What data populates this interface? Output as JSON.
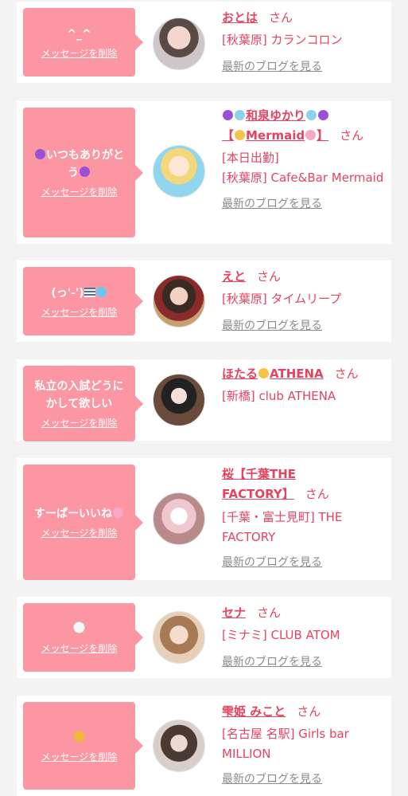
{
  "common": {
    "delete_label": "メッセージを削除",
    "honorific": "さん",
    "blog_label": "最新のブログを見る"
  },
  "cards": [
    {
      "message": "^_^",
      "name": "おとは",
      "store_lines": [
        "[秋葉原] カランコロン"
      ]
    },
    {
      "message_pre": "",
      "message_text": "いつもありがとう",
      "message_post": "",
      "message_icons": [
        "purple-heart-icon",
        "purple-heart-icon"
      ],
      "name_part1": "和泉ゆかり",
      "name_part2": "【",
      "name_part3": "Mermaid",
      "name_part4": "】",
      "name_icons": [
        "purple-heart-icon",
        "snowflake-icon",
        "snowflake-icon",
        "purple-heart-icon",
        "bouquet-icon",
        "mermaid-icon"
      ],
      "store_lines": [
        "[本日出勤]",
        "[秋葉原] Cafe&Bar Mermaid"
      ]
    },
    {
      "message_text": "(っ'-')",
      "message_icons": [
        "wave-lines-icon",
        "blue-heart-icon"
      ],
      "name": "えと",
      "store_lines": [
        "[秋葉原] タイムリープ"
      ]
    },
    {
      "message": "私立の入試どうにかして欲しい",
      "name_part1": "ほたる",
      "name_part2": "ATHENA",
      "name_icons": [
        "shooting-star-icon"
      ],
      "store_lines": [
        "[新橋] club ATHENA"
      ]
    },
    {
      "message_text": "すーぱーいいね",
      "message_icons": [
        "cherry-blossom-icon"
      ],
      "name": "桜【千葉THE FACTORY】",
      "store_lines": [
        "[千葉・富士見町] THE FACTORY"
      ]
    },
    {
      "message_icons": [
        "white-heart-icon"
      ],
      "name": "セナ",
      "store_lines": [
        "[ミナミ] CLUB ATOM"
      ]
    },
    {
      "message_icons": [
        "heart-hands-icon"
      ],
      "name": "雫姫 みこと",
      "store_lines": [
        "[名古屋 名駅] Girls bar MILLION"
      ]
    }
  ],
  "colors": {
    "accent_pink": "#fc96a3",
    "link_pink": "#e6435f",
    "muted_gray": "#8b8b8b",
    "background": "#f3f3f3"
  }
}
